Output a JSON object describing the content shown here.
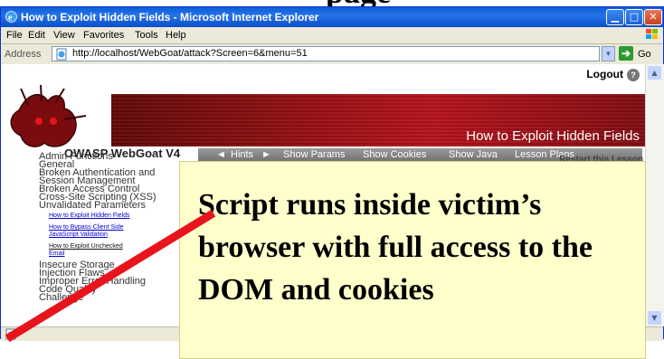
{
  "slide": {
    "title_fragment": "page"
  },
  "window": {
    "title": "How to Exploit Hidden Fields - Microsoft Internet Explorer"
  },
  "menu": {
    "items": [
      {
        "label": "File",
        "mnemonic": "F"
      },
      {
        "label": "Edit",
        "mnemonic": "E"
      },
      {
        "label": "View",
        "mnemonic": "V"
      },
      {
        "label": "Favorites",
        "mnemonic": "a"
      },
      {
        "label": "Tools",
        "mnemonic": "T"
      },
      {
        "label": "Help",
        "mnemonic": "H"
      }
    ]
  },
  "address": {
    "label": "Address",
    "url": "http://localhost/WebGoat/attack?Screen=6&menu=51",
    "go_label": "Go"
  },
  "page": {
    "logout": "Logout",
    "banner_title": "How to Exploit Hidden Fields",
    "brand": "OWASP WebGoat V4",
    "nav": [
      "Hints",
      "Show Params",
      "Show Cookies",
      "Show Java",
      "Lesson Plans"
    ],
    "restart": "Restart this Lesson",
    "categories": [
      "Admin Functions",
      "General",
      "Broken Authentication and",
      "Session Management",
      "Broken Access Control",
      "Cross-Site Scripting (XSS)",
      "Unvalidated Parameters"
    ],
    "lessons": [
      "How to Exploit Hidden Fields",
      "How to Bypass Client Side",
      "JavaScript Validation",
      "How to Exploit Unchecked",
      "Email"
    ],
    "categories_after": [
      "Insecure Storage",
      "Injection Flaws",
      "Improper Error Handling",
      "Code Quality",
      "Challenge"
    ]
  },
  "callout": {
    "text": "Script runs inside victim’s browser with full access to the DOM and cookies"
  },
  "colors": {
    "banner_red": "#B4121A",
    "callout_bg": "#FFFFCC",
    "slash": "#E8141C",
    "titlebar": "#0A5FD8"
  }
}
